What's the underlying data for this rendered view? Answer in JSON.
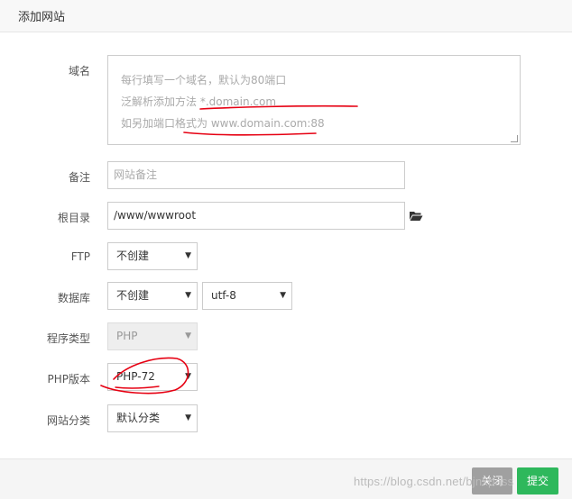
{
  "dialog": {
    "title": "添加网站"
  },
  "form": {
    "domain": {
      "label": "域名",
      "lines": [
        "每行填写一个域名，默认为80端口",
        "泛解析添加方法 *.domain.com",
        "如另加端口格式为 www.domain.com:88"
      ]
    },
    "note": {
      "label": "备注",
      "placeholder": "网站备注"
    },
    "root": {
      "label": "根目录",
      "value": "/www/wwwroot"
    },
    "ftp": {
      "label": "FTP",
      "selected": "不创建"
    },
    "database": {
      "label": "数据库",
      "selected": "不创建",
      "charset": "utf-8"
    },
    "program": {
      "label": "程序类型",
      "selected": "PHP"
    },
    "php": {
      "label": "PHP版本",
      "selected": "PHP-72"
    },
    "category": {
      "label": "网站分类",
      "selected": "默认分类"
    }
  },
  "footer": {
    "close_label": "关闭",
    "submit_label": "提交"
  },
  "watermark": "https://blog.csdn.net/bjnxpass",
  "colors": {
    "submit": "#2eb85c",
    "close": "#a0a0a0",
    "annotation": "#e60012"
  }
}
